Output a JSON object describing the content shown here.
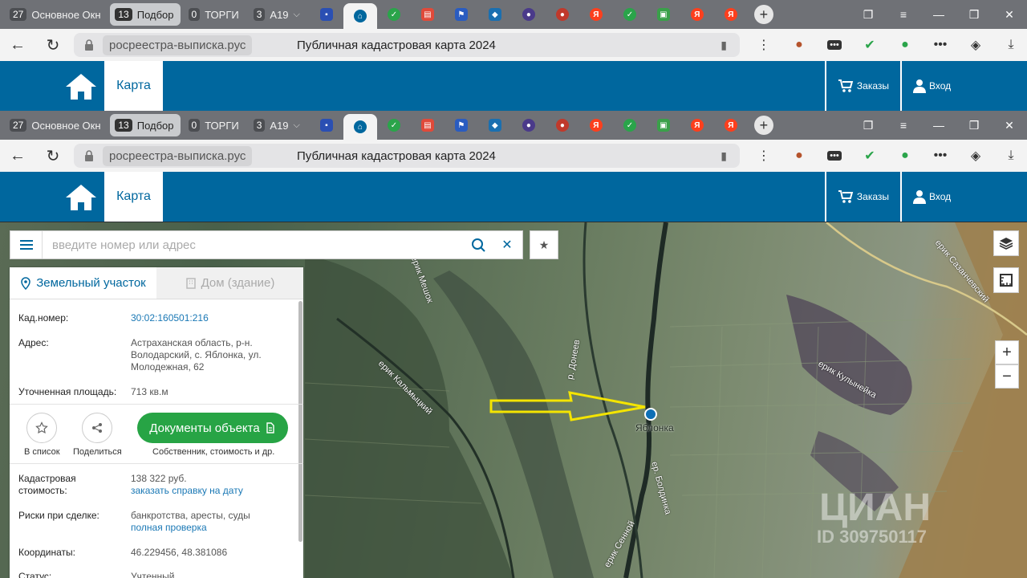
{
  "browser": {
    "tab_groups": [
      {
        "count": "27",
        "name": "Основное Окно"
      },
      {
        "count": "13",
        "name": "Подбор"
      },
      {
        "count": "0",
        "name": "ТОРГИ"
      },
      {
        "count": "3",
        "name": "А19"
      }
    ],
    "url_host": "росреестра-выписка.рус",
    "page_title": "Публичная кадастровая карта 2024"
  },
  "site": {
    "nav_map": "Карта",
    "orders": "Заказы",
    "login": "Вход"
  },
  "search": {
    "placeholder": "введите номер или адрес"
  },
  "panel": {
    "tab_land": "Земельный участок",
    "tab_house": "Дом (здание)",
    "kad_label": "Кад.номер:",
    "kad_value": "30:02:160501:216",
    "addr_label": "Адрес:",
    "addr_value": "Астраханская область, р-н. Володарский, с. Яблонка, ул. Молодежная, 62",
    "area_label": "Уточненная площадь:",
    "area_value": "713 кв.м",
    "act_list": "В список",
    "act_share": "Поделиться",
    "doc_button": "Документы объекта",
    "doc_sub": "Собственник, стоимость и др.",
    "cost_label": "Кадастровая стоимость:",
    "cost_value": "138 322 руб.",
    "cost_link": "заказать справку на дату",
    "risk_label": "Риски при сделке:",
    "risk_value": "банкротства, аресты, суды",
    "risk_link": "полная проверка",
    "coords_label": "Координаты:",
    "coords_value": "46.229456, 48.381086",
    "status_label": "Статус:",
    "status_value": "Учтенный"
  },
  "map": {
    "place_label": "Яблонка",
    "river_labels": [
      "ерик Мешок",
      "р. Донеев",
      "ерик Кальмыцкий",
      "ерик Кулынейка",
      "ерик Сазанчевский",
      "ер. Болдинка",
      "ерик Сенной"
    ],
    "watermark_brand": "ЦИАН",
    "watermark_id": "ID 309750117"
  },
  "colors": {
    "header_blue": "#00679e",
    "doc_green": "#27a445",
    "link_blue": "#1a78b5",
    "arrow_yellow": "#f4e400"
  }
}
